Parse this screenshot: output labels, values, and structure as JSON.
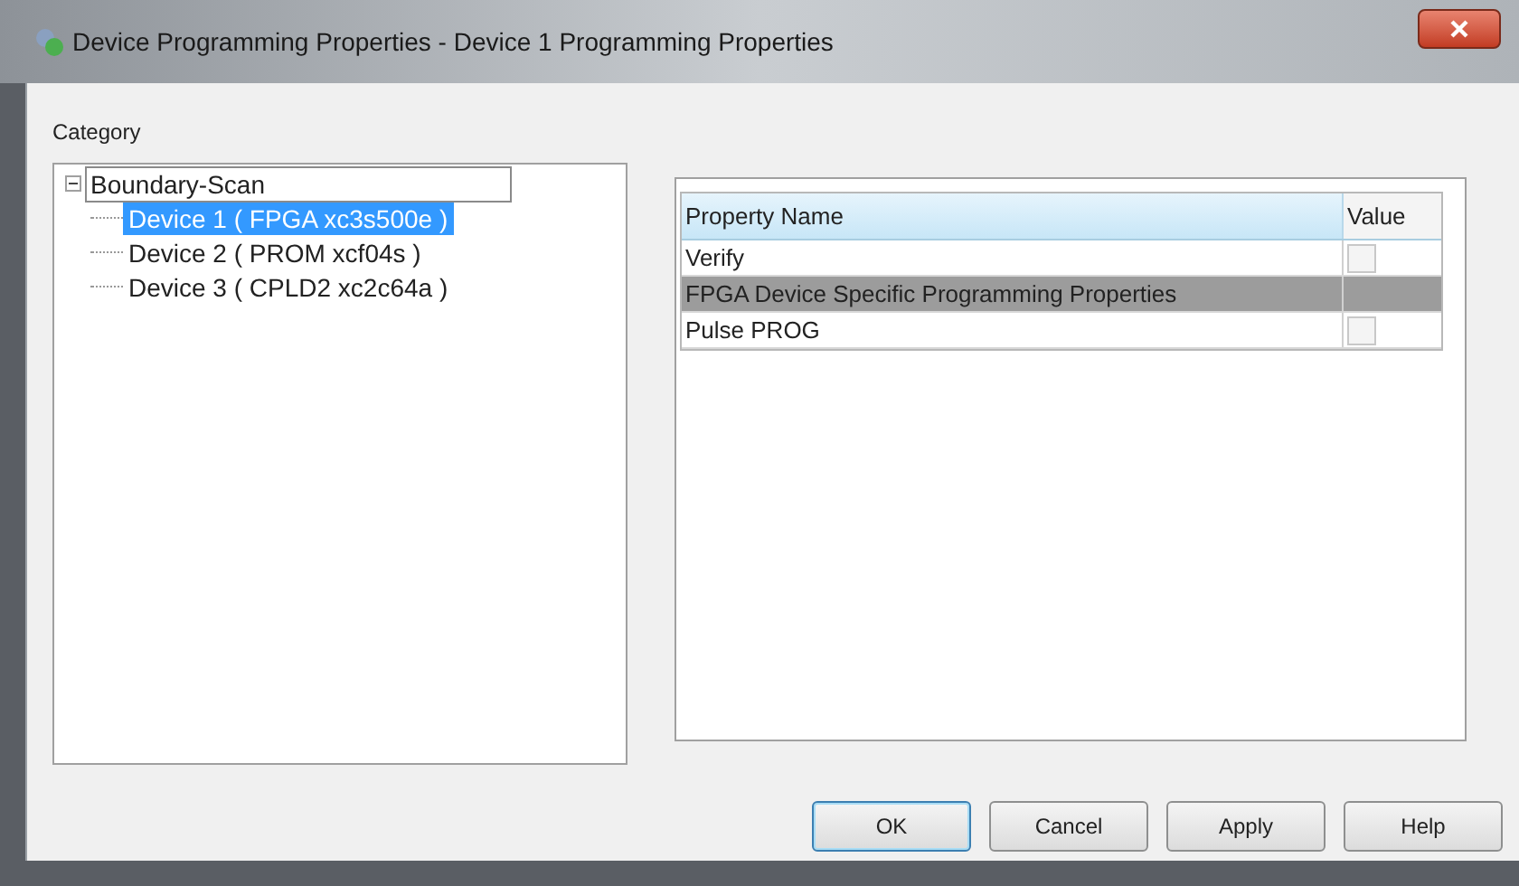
{
  "window": {
    "title": "Device Programming Properties - Device 1 Programming Properties"
  },
  "category": {
    "label": "Category",
    "tree": [
      {
        "label": "Boundary-Scan",
        "expanded": true,
        "selected": false,
        "children": [
          {
            "label": "Device 1 ( FPGA xc3s500e )",
            "selected": true
          },
          {
            "label": "Device 2 ( PROM xcf04s )",
            "selected": false
          },
          {
            "label": "Device 3 ( CPLD2 xc2c64a )",
            "selected": false
          }
        ]
      }
    ]
  },
  "properties": {
    "columns": [
      "Property Name",
      "Value"
    ],
    "rows": [
      {
        "kind": "checkbox",
        "name": "Verify",
        "checked": false
      },
      {
        "kind": "category",
        "name": "FPGA Device Specific Programming Properties"
      },
      {
        "kind": "checkbox",
        "name": "Pulse PROG",
        "checked": false
      }
    ]
  },
  "buttons": [
    {
      "label": "OK",
      "default": true
    },
    {
      "label": "Cancel",
      "default": false
    },
    {
      "label": "Apply",
      "default": false
    },
    {
      "label": "Help",
      "default": false
    }
  ]
}
